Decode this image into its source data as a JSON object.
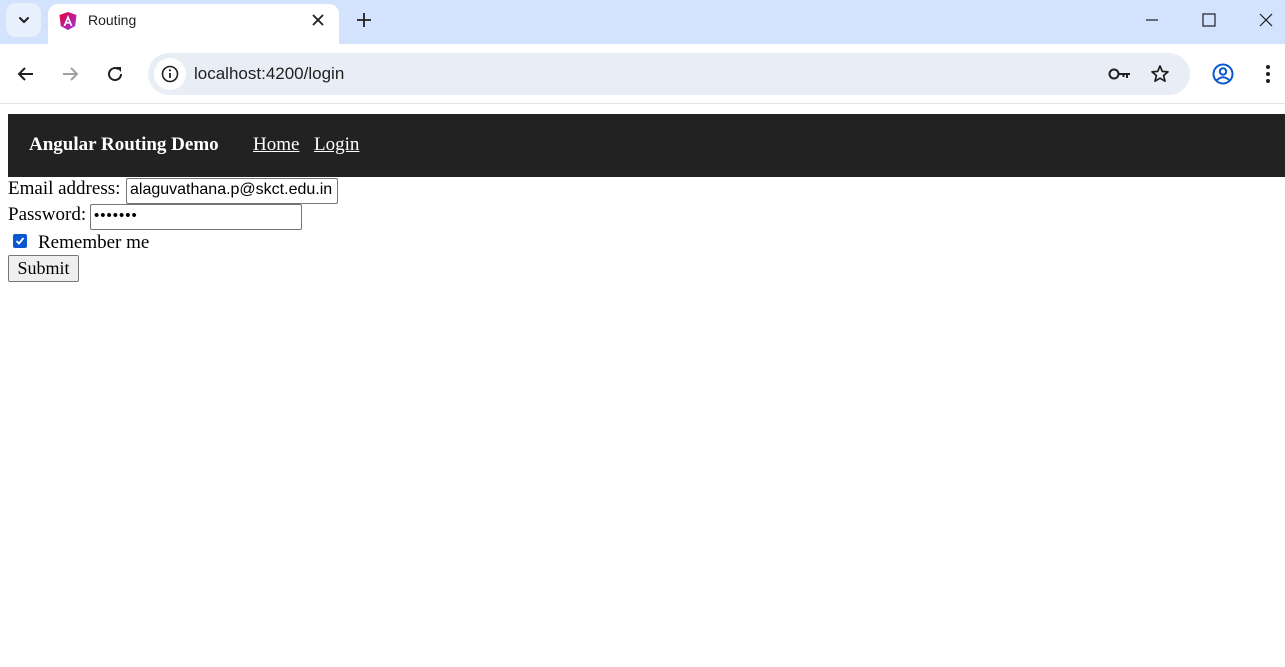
{
  "browser": {
    "tab": {
      "title": "Routing"
    },
    "address_bar": {
      "url": "localhost:4200/login"
    }
  },
  "app": {
    "brand": "Angular Routing Demo",
    "nav_links": [
      {
        "label": "Home"
      },
      {
        "label": "Login"
      }
    ]
  },
  "login_form": {
    "email_label": "Email address:",
    "email_value": "alaguvathana.p@skct.edu.in",
    "password_label": "Password:",
    "password_value": "•••••••",
    "remember_label": "Remember me",
    "remember_checked": true,
    "submit_label": "Submit"
  },
  "colors": {
    "tabstrip_bg": "#d3e3fd",
    "navbar_bg": "#222222",
    "checkbox_accent": "#0b57d0"
  }
}
